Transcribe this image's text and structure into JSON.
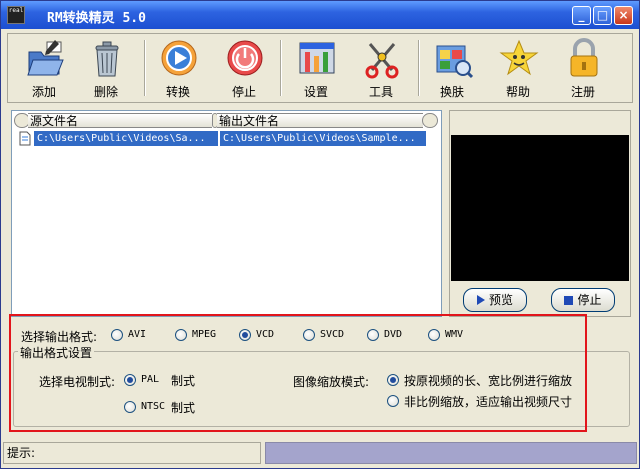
{
  "window": {
    "title": "RM转换精灵 5.0",
    "icon_text": "real",
    "controls": {
      "minimize": "_",
      "maximize": "□",
      "close": "×"
    }
  },
  "toolbar": {
    "items": [
      {
        "label": "添加",
        "icon": "add-folder-icon"
      },
      {
        "label": "删除",
        "icon": "trash-can-icon"
      },
      {
        "label": "转换",
        "icon": "play-circle-icon"
      },
      {
        "label": "停止",
        "icon": "power-stop-icon"
      },
      {
        "label": "设置",
        "icon": "settings-tools-icon"
      },
      {
        "label": "工具",
        "icon": "scissors-icon"
      },
      {
        "label": "换肤",
        "icon": "skin-icon"
      },
      {
        "label": "帮助",
        "icon": "star-face-icon"
      },
      {
        "label": "注册",
        "icon": "padlock-icon"
      }
    ]
  },
  "file_list": {
    "columns": [
      "源文件名",
      "输出文件名"
    ],
    "rows": [
      {
        "source": "C:\\Users\\Public\\Videos\\Sa...",
        "output": "C:\\Users\\Public\\Videos\\Sample..."
      }
    ]
  },
  "preview": {
    "preview_label": "预览",
    "stop_label": "停止"
  },
  "output_format": {
    "label": "选择输出格式:",
    "options": [
      "AVI",
      "MPEG",
      "VCD",
      "SVCD",
      "DVD",
      "WMV"
    ],
    "selected": "VCD"
  },
  "settings": {
    "group_title": "输出格式设置",
    "tv_system_label": "选择电视制式:",
    "tv_options": [
      "PAL",
      "NTSC"
    ],
    "tv_suffix": "制式",
    "tv_selected": "PAL",
    "scale_label": "图像缩放模式:",
    "scale_options": [
      "按原视频的长、宽比例进行缩放",
      "非比例缩放，适应输出视频尺寸"
    ],
    "scale_selected": 0
  },
  "status": {
    "hint_label": "提示:"
  },
  "colors": {
    "title_bar": "#2d63e0",
    "selection": "#316ac5",
    "highlight_box": "#e2151b",
    "status_right": "#a4a4cc"
  }
}
